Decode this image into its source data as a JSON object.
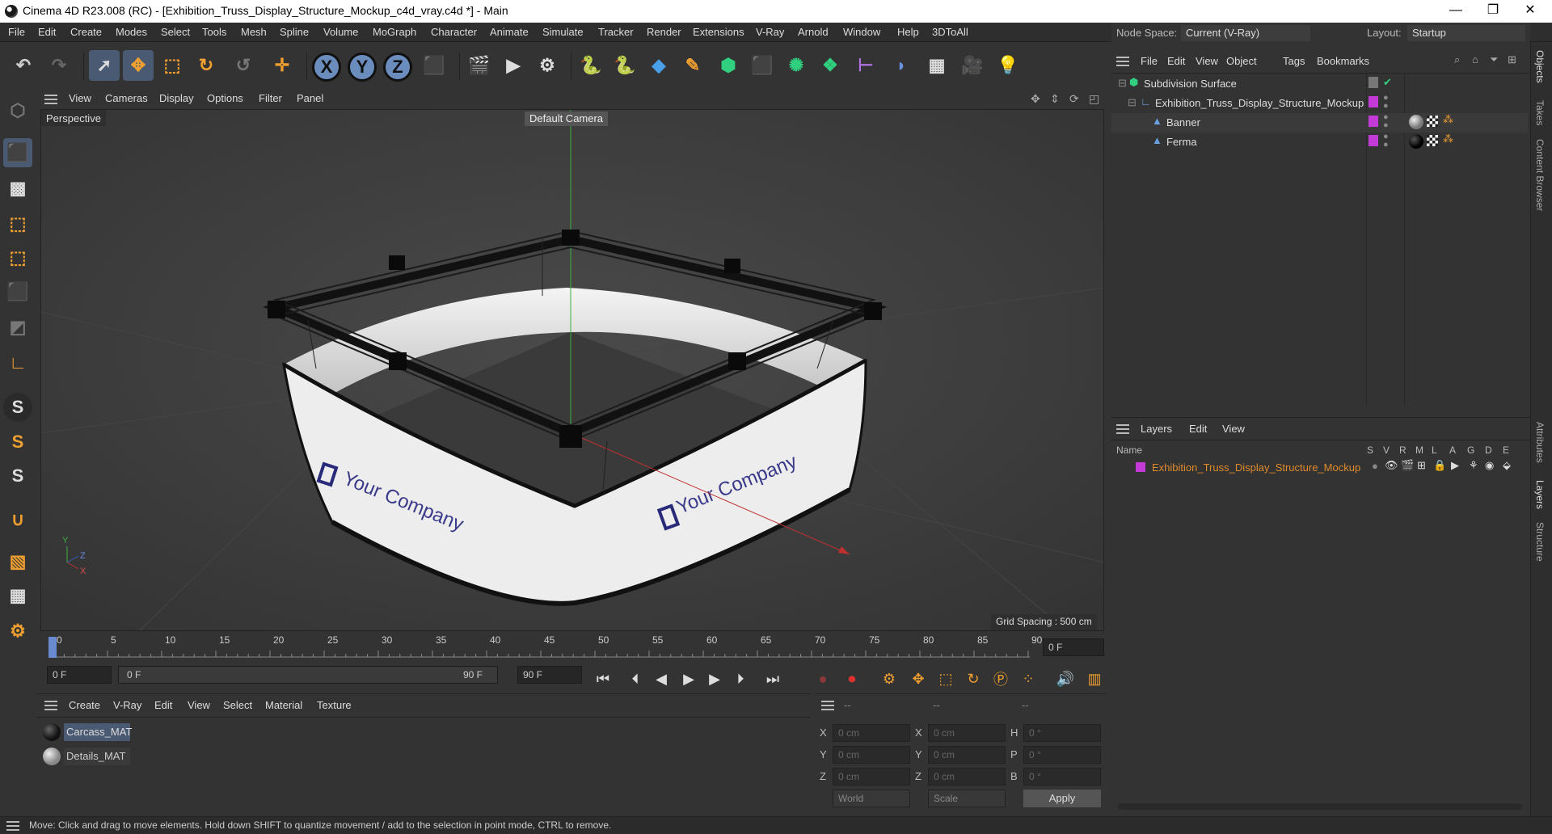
{
  "window": {
    "title": "Cinema 4D R23.008 (RC) - [Exhibition_Truss_Display_Structure_Mockup_c4d_vray.c4d *] - Main",
    "controls": {
      "minimize": "—",
      "maximize": "❐",
      "close": "✕"
    }
  },
  "menu": [
    "File",
    "Edit",
    "Create",
    "Modes",
    "Select",
    "Tools",
    "Mesh",
    "Spline",
    "Volume",
    "MoGraph",
    "Character",
    "Animate",
    "Simulate",
    "Tracker",
    "Render",
    "Extensions",
    "V-Ray",
    "Arnold",
    "Window",
    "Help",
    "3DToAll"
  ],
  "header_right": {
    "node_space_label": "Node Space:",
    "node_space_value": "Current (V-Ray)",
    "layout_label": "Layout:",
    "layout_value": "Startup"
  },
  "toolbar": {
    "axis_x": "X",
    "axis_y": "Y",
    "axis_z": "Z"
  },
  "viewport": {
    "menu": [
      "View",
      "Cameras",
      "Display",
      "Options",
      "Filter",
      "Panel"
    ],
    "label": "Perspective",
    "camera": "Default Camera",
    "grid_spacing": "Grid Spacing : 500 cm",
    "banner_text_left": "Your Company",
    "banner_text_right": "Your Company",
    "axis_y": "Y",
    "axis_z": "Z",
    "axis_x": "X"
  },
  "timeline": {
    "ticks": [
      "0",
      "5",
      "10",
      "15",
      "20",
      "25",
      "30",
      "35",
      "40",
      "45",
      "50",
      "55",
      "60",
      "65",
      "70",
      "75",
      "80",
      "85",
      "90"
    ],
    "current_frame": "0 F"
  },
  "transport": {
    "start_field": "0 F",
    "range_start": "0 F",
    "range_end": "90 F",
    "end_field": "90 F"
  },
  "materials": {
    "menu": [
      "Create",
      "V-Ray",
      "Edit",
      "View",
      "Select",
      "Material",
      "Texture"
    ],
    "items": [
      {
        "name": "Carcass_MAT",
        "selected": true
      },
      {
        "name": "Details_MAT",
        "selected": false
      }
    ]
  },
  "coords": {
    "headers": [
      "--",
      "--",
      "--"
    ],
    "rows": [
      {
        "a": "X",
        "av": "0 cm",
        "b": "X",
        "bv": "0 cm",
        "c": "H",
        "cv": "0 °"
      },
      {
        "a": "Y",
        "av": "0 cm",
        "b": "Y",
        "bv": "0 cm",
        "c": "P",
        "cv": "0 °"
      },
      {
        "a": "Z",
        "av": "0 cm",
        "b": "Z",
        "bv": "0 cm",
        "c": "B",
        "cv": "0 °"
      }
    ],
    "world": "World",
    "scale": "Scale",
    "apply": "Apply"
  },
  "objects": {
    "menu": [
      "File",
      "Edit",
      "View",
      "Object",
      "Tags",
      "Bookmarks"
    ],
    "tree": [
      {
        "name": "Subdivision Surface"
      },
      {
        "name": "Exhibition_Truss_Display_Structure_Mockup"
      },
      {
        "name": "Banner"
      },
      {
        "name": "Ferma"
      }
    ]
  },
  "layers": {
    "menu": [
      "Layers",
      "Edit",
      "View"
    ],
    "name_header": "Name",
    "columns": [
      "S",
      "V",
      "R",
      "M",
      "L",
      "A",
      "G",
      "D",
      "E"
    ],
    "items": [
      {
        "name": "Exhibition_Truss_Display_Structure_Mockup"
      }
    ]
  },
  "side_tabs": [
    "Objects",
    "Takes",
    "Content Browser",
    "Attributes",
    "Layers",
    "Structure"
  ],
  "status": "Move: Click and drag to move elements. Hold down SHIFT to quantize movement / add to the selection in point mode, CTRL to remove.",
  "colors": {
    "accent_magenta": "#c33ad6",
    "layer_text": "#e08a2a",
    "selection_blue": "#4a5a72"
  }
}
